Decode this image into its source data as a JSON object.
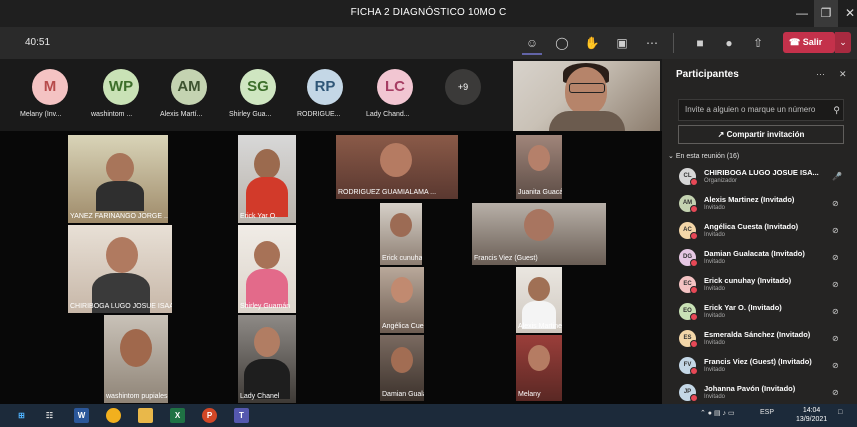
{
  "window": {
    "title": "FICHA 2 DIAGNÓSTICO 10MO C",
    "minimize": "—",
    "restore": "❐",
    "close": "✕"
  },
  "toolbar": {
    "timer": "40:51",
    "icons": [
      "people-icon",
      "chat-icon",
      "reactions-icon",
      "rooms-icon",
      "more-icon",
      "camera-icon",
      "mic-icon",
      "share-icon"
    ],
    "leave_label": "Salir",
    "leave_color": "#c4314b"
  },
  "avatars": [
    {
      "initials": "M",
      "name": "Melany (Inv...",
      "color": "#f4c3c3"
    },
    {
      "initials": "WP",
      "name": "washintom ...",
      "color": "#c9e2b6"
    },
    {
      "initials": "AM",
      "name": "Alexis Martí...",
      "color": "#c4d3b1"
    },
    {
      "initials": "SG",
      "name": "Shirley Gua...",
      "color": "#cfe6c1"
    },
    {
      "initials": "RP",
      "name": "RODRIGUE...",
      "color": "#c4d7e6"
    },
    {
      "initials": "LC",
      "name": "Lady Chand...",
      "color": "#f2c6d2"
    }
  ],
  "more_count": "+9",
  "tiles": [
    {
      "name": "YANEZ FARINANGO JORGE ..."
    },
    {
      "name": "Erick Yar O."
    },
    {
      "name": "RODRIGUEZ GUAMIALAMA ..."
    },
    {
      "name": "Juanita Guacán"
    },
    {
      "name": "CHIRIBOGA LUGO JOSUE ISAAC"
    },
    {
      "name": "Shirley Guamán"
    },
    {
      "name": "Erick cunuhay"
    },
    {
      "name": "Francis Viez (Guest)"
    },
    {
      "name": "Angélica Cuesta"
    },
    {
      "name": "Alexis Martinez"
    },
    {
      "name": "washintom pupiales"
    },
    {
      "name": "Lady Chanel"
    },
    {
      "name": "Damian Gualacata"
    },
    {
      "name": "Melany"
    }
  ],
  "panel": {
    "title": "Participantes",
    "more": "···",
    "close": "✕",
    "invite_placeholder": "Invite a alguien o marque un número",
    "share_label": "Compartir invitación",
    "section": "En esta reunión (16)",
    "participants": [
      {
        "initials": "CL",
        "name": "CHIRIBOGA LUGO JOSUE ISA...",
        "role": "Organizador",
        "color": "#d6d6d6",
        "mic": "on"
      },
      {
        "initials": "AM",
        "name": "Alexis Martinez (Invitado)",
        "role": "Invitado",
        "color": "#c4d3b1",
        "mic": "muted"
      },
      {
        "initials": "AC",
        "name": "Angélica Cuesta (Invitado)",
        "role": "Invitado",
        "color": "#f3d6a8",
        "mic": "muted"
      },
      {
        "initials": "DG",
        "name": "Damian Gualacata (Invitado)",
        "role": "Invitado",
        "color": "#e6c7e3",
        "mic": "muted"
      },
      {
        "initials": "EC",
        "name": "Erick cunuhay (Invitado)",
        "role": "Invitado",
        "color": "#f4c3c3",
        "mic": "muted"
      },
      {
        "initials": "EO",
        "name": "Erick Yar O. (Invitado)",
        "role": "Invitado",
        "color": "#c9e2b6",
        "mic": "muted"
      },
      {
        "initials": "ES",
        "name": "Esmeralda Sánchez (Invitado)",
        "role": "Invitado",
        "color": "#f3d6a8",
        "mic": "muted"
      },
      {
        "initials": "FV",
        "name": "Francis Viez (Guest) (Invitado)",
        "role": "Invitado",
        "color": "#c4d7e6",
        "mic": "muted"
      },
      {
        "initials": "JP",
        "name": "Johanna Pavón (Invitado)",
        "role": "Invitado",
        "color": "#c4d7e6",
        "mic": "muted"
      }
    ]
  },
  "taskbar": {
    "apps": [
      "windows-icon",
      "taskview-icon",
      "word-icon",
      "chrome-icon",
      "files-icon",
      "excel-icon",
      "powerpoint-icon",
      "teams-icon"
    ],
    "tray": "ESP",
    "time": "14:04",
    "date": "13/9/2021"
  }
}
